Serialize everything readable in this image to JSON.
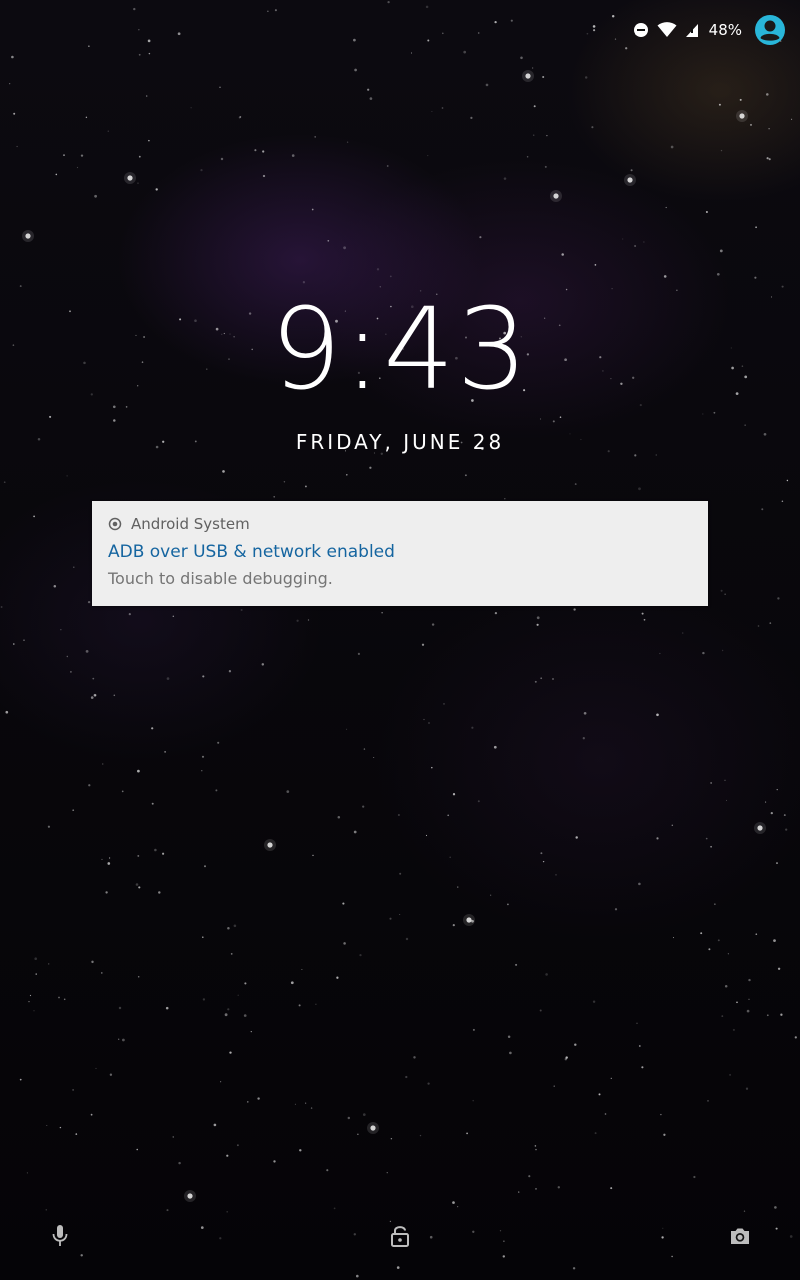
{
  "status_bar": {
    "battery_percent": "48%",
    "icons": [
      "do-not-disturb-icon",
      "wifi-icon",
      "signal-icon",
      "user-avatar-icon"
    ],
    "accent_color": "#29b6d9"
  },
  "lockscreen": {
    "time": "9:43",
    "date": "FRIDAY, JUNE 28"
  },
  "notification": {
    "app_name": "Android System",
    "title": "ADB over USB & network enabled",
    "text": "Touch to disable debugging.",
    "title_color": "#1565a0"
  },
  "bottom_actions": {
    "icons": [
      "microphone-icon",
      "lock-icon",
      "camera-icon"
    ]
  }
}
